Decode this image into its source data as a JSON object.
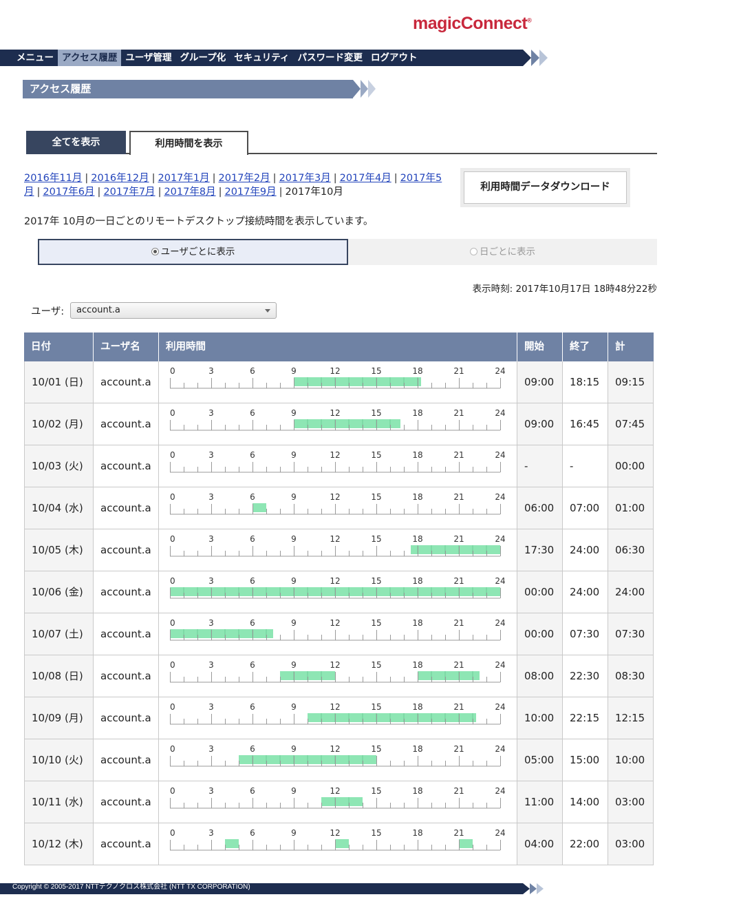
{
  "logo": {
    "text": "magicConnect",
    "mark": "®"
  },
  "nav": {
    "items": [
      "メニュー",
      "アクセス履歴",
      "ユーザ管理",
      "グループ化",
      "セキュリティ",
      "パスワード変更",
      "ログアウト"
    ],
    "active_index": 1
  },
  "section_title": "アクセス履歴",
  "tabs": {
    "all": "全てを表示",
    "usage": "利用時間を表示"
  },
  "months": {
    "links": [
      "2016年11月",
      "2016年12月",
      "2017年1月",
      "2017年2月",
      "2017年3月",
      "2017年4月",
      "2017年5月",
      "2017年6月",
      "2017年7月",
      "2017年8月",
      "2017年9月"
    ],
    "current": "2017年10月",
    "separator": "|"
  },
  "download_button": "利用時間データダウンロード",
  "description": "2017年 10月の一日ごとのリモートデスクトップ接続時間を表示しています。",
  "view_toggle": {
    "by_user": "ユーザごとに表示",
    "by_day": "日ごとに表示",
    "selected": "by_user"
  },
  "display_time": "表示時刻: 2017年10月17日 18時48分22秒",
  "user_filter": {
    "label": "ユーザ:",
    "selected": "account.a"
  },
  "table": {
    "headers": [
      "日付",
      "ユーザ名",
      "利用時間",
      "開始",
      "終了",
      "計"
    ],
    "hour_labels": [
      "0",
      "3",
      "6",
      "9",
      "12",
      "15",
      "18",
      "21",
      "24"
    ],
    "rows": [
      {
        "date": "10/01 (日)",
        "user": "account.a",
        "start": "09:00",
        "end": "18:15",
        "total": "09:15",
        "segments": [
          [
            9,
            18.25
          ]
        ]
      },
      {
        "date": "10/02 (月)",
        "user": "account.a",
        "start": "09:00",
        "end": "16:45",
        "total": "07:45",
        "segments": [
          [
            9,
            16.75
          ]
        ]
      },
      {
        "date": "10/03 (火)",
        "user": "account.a",
        "start": "-",
        "end": "-",
        "total": "00:00",
        "segments": []
      },
      {
        "date": "10/04 (水)",
        "user": "account.a",
        "start": "06:00",
        "end": "07:00",
        "total": "01:00",
        "segments": [
          [
            6,
            7
          ]
        ]
      },
      {
        "date": "10/05 (木)",
        "user": "account.a",
        "start": "17:30",
        "end": "24:00",
        "total": "06:30",
        "segments": [
          [
            17.5,
            24
          ]
        ]
      },
      {
        "date": "10/06 (金)",
        "user": "account.a",
        "start": "00:00",
        "end": "24:00",
        "total": "24:00",
        "segments": [
          [
            0,
            24
          ]
        ]
      },
      {
        "date": "10/07 (土)",
        "user": "account.a",
        "start": "00:00",
        "end": "07:30",
        "total": "07:30",
        "segments": [
          [
            0,
            7.5
          ]
        ]
      },
      {
        "date": "10/08 (日)",
        "user": "account.a",
        "start": "08:00",
        "end": "22:30",
        "total": "08:30",
        "segments": [
          [
            8,
            12
          ],
          [
            18,
            22.5
          ]
        ]
      },
      {
        "date": "10/09 (月)",
        "user": "account.a",
        "start": "10:00",
        "end": "22:15",
        "total": "12:15",
        "segments": [
          [
            10,
            22.25
          ]
        ]
      },
      {
        "date": "10/10 (火)",
        "user": "account.a",
        "start": "05:00",
        "end": "15:00",
        "total": "10:00",
        "segments": [
          [
            5,
            15
          ]
        ]
      },
      {
        "date": "10/11 (水)",
        "user": "account.a",
        "start": "11:00",
        "end": "14:00",
        "total": "03:00",
        "segments": [
          [
            11,
            14
          ]
        ]
      },
      {
        "date": "10/12 (木)",
        "user": "account.a",
        "start": "04:00",
        "end": "22:00",
        "total": "03:00",
        "segments": [
          [
            4,
            5
          ],
          [
            12,
            13
          ],
          [
            21,
            22
          ]
        ]
      }
    ]
  },
  "footer": "Copyright © 2005-2017 NTTテクノクロス株式会社 (NTT TX CORPORATION)",
  "colors": {
    "nav_bg": "#1d2d4f",
    "header_bg": "#6f82a4",
    "bar": "#8ee6b4",
    "link": "#2244bb",
    "brand": "#c8283c"
  }
}
